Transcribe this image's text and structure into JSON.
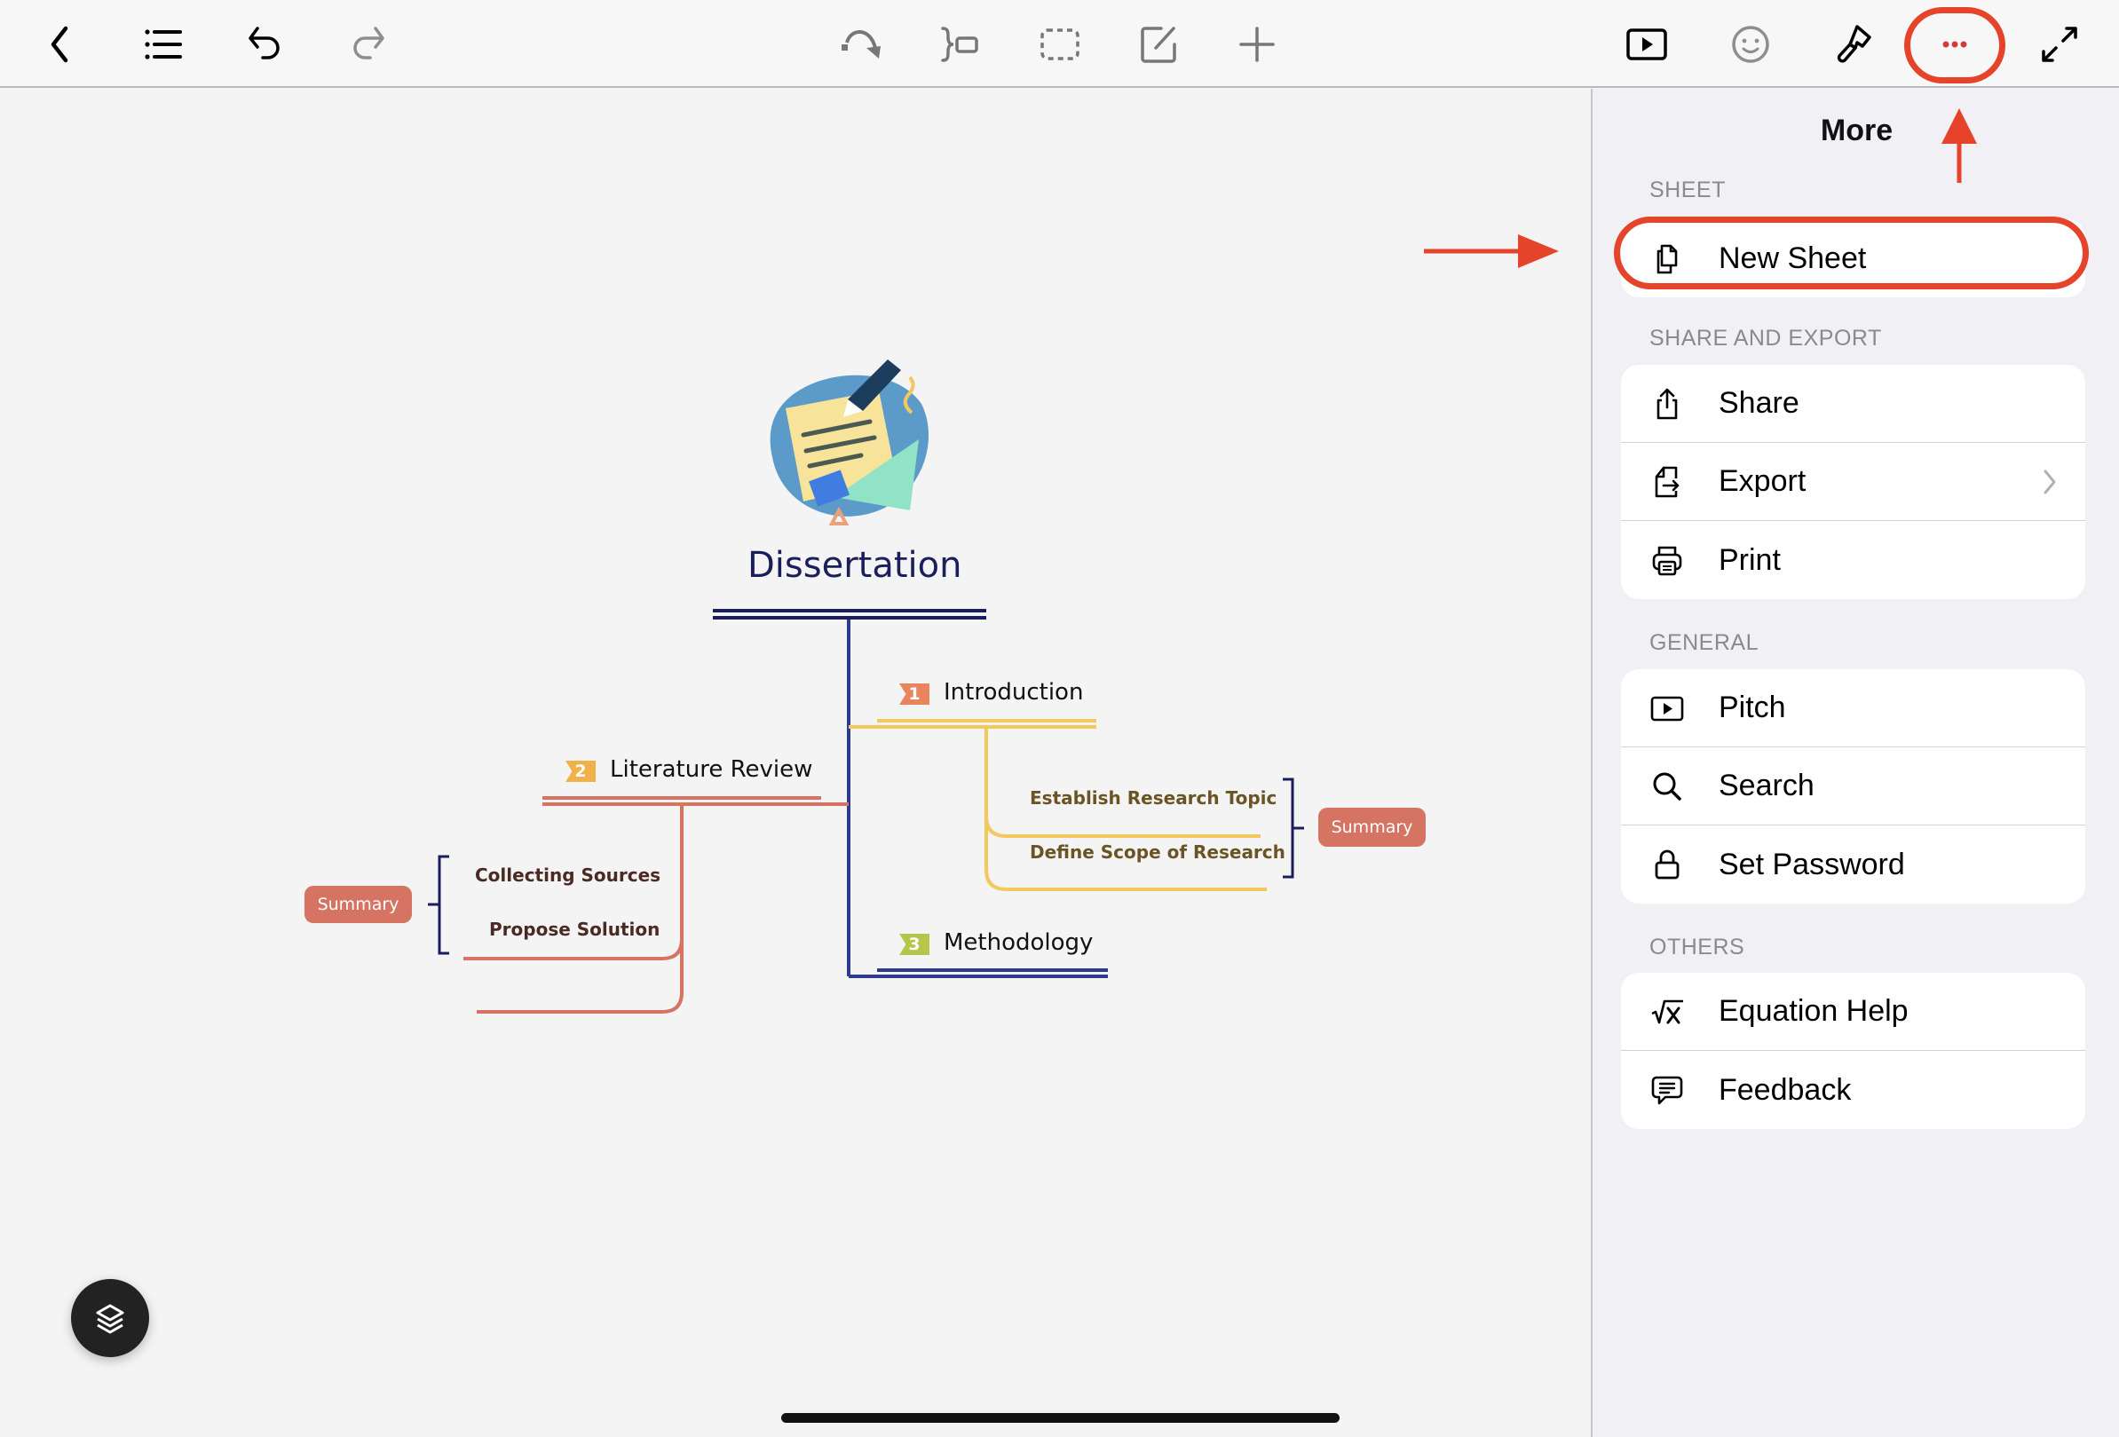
{
  "toolbar": {
    "left": [
      {
        "name": "back",
        "icon": "chevron-left-icon"
      },
      {
        "name": "outline",
        "icon": "list-icon"
      },
      {
        "name": "undo",
        "icon": "undo-icon"
      },
      {
        "name": "redo",
        "icon": "redo-icon",
        "disabled": true
      }
    ],
    "center": [
      {
        "name": "relationship",
        "icon": "relationship-arrow-icon"
      },
      {
        "name": "summary",
        "icon": "summary-bracket-icon"
      },
      {
        "name": "boundary",
        "icon": "boundary-dashed-icon"
      },
      {
        "name": "note",
        "icon": "note-edit-icon"
      },
      {
        "name": "add-topic",
        "icon": "plus-icon"
      }
    ],
    "right": [
      {
        "name": "pitch",
        "icon": "play-icon"
      },
      {
        "name": "sticker",
        "icon": "smiley-icon"
      },
      {
        "name": "format",
        "icon": "paintbrush-icon"
      },
      {
        "name": "more",
        "icon": "ellipsis-icon",
        "highlighted": true
      },
      {
        "name": "fullscreen",
        "icon": "expand-icon"
      }
    ]
  },
  "mindmap": {
    "central_topic": "Dissertation",
    "topics": [
      {
        "number": "1",
        "label": "Introduction",
        "color": "#f2c85f",
        "badge_color": "#e8855f",
        "subtopics": [
          "Establish Research Topic",
          "Define Scope of Research"
        ],
        "summary": "Summary"
      },
      {
        "number": "2",
        "label": "Literature Review",
        "color": "#d67463",
        "badge_color": "#f0b04a",
        "subtopics": [
          "Collecting Sources",
          "Propose Solution"
        ],
        "summary": "Summary"
      },
      {
        "number": "3",
        "label": "Methodology",
        "color": "#2e3a8c",
        "badge_color": "#b6c64a",
        "subtopics": [],
        "summary": null
      }
    ]
  },
  "layers_button": {
    "icon": "layers-icon"
  },
  "panel": {
    "title": "More",
    "sections": [
      {
        "label": "SHEET",
        "items": [
          {
            "label": "New Sheet",
            "icon": "new-sheet-icon",
            "highlighted": true
          }
        ]
      },
      {
        "label": "SHARE AND EXPORT",
        "items": [
          {
            "label": "Share",
            "icon": "share-icon"
          },
          {
            "label": "Export",
            "icon": "export-icon",
            "has_submenu": true
          },
          {
            "label": "Print",
            "icon": "printer-icon"
          }
        ]
      },
      {
        "label": "GENERAL",
        "items": [
          {
            "label": "Pitch",
            "icon": "play-icon"
          },
          {
            "label": "Search",
            "icon": "search-icon"
          },
          {
            "label": "Set Password",
            "icon": "lock-icon"
          }
        ]
      },
      {
        "label": "OTHERS",
        "items": [
          {
            "label": "Equation Help",
            "icon": "sqrt-x-icon"
          },
          {
            "label": "Feedback",
            "icon": "feedback-bubble-icon"
          }
        ]
      }
    ]
  },
  "annotations": {
    "color": "#e5432a",
    "arrows": [
      "arrow-up-to-more-button",
      "arrow-right-to-new-sheet"
    ]
  }
}
